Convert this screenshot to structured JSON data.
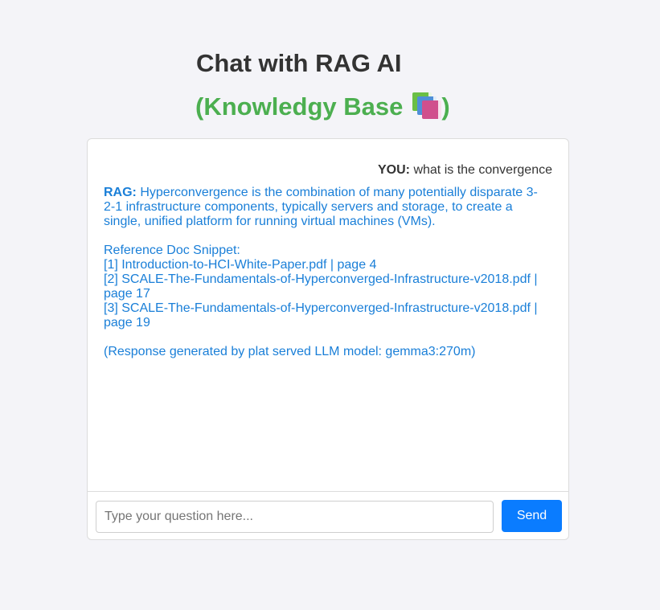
{
  "header": {
    "title": "Chat with RAG AI",
    "subtitle_open": "(Knowledgy Base",
    "subtitle_close": ")",
    "subtitle_icon": "books-icon"
  },
  "chat": {
    "user_message": {
      "speaker": "YOU:",
      "text": "what is the convergence"
    },
    "rag_message": {
      "speaker": "RAG:",
      "answer": "Hyperconvergence is the combination of many potentially disparate 3-2-1 infrastructure components, typically servers and storage, to create a single, unified platform for running virtual machines (VMs).",
      "reference_heading": "Reference Doc Snippet:",
      "references": [
        "[1] Introduction-to-HCI-White-Paper.pdf | page 4",
        "[2] SCALE-The-Fundamentals-of-Hyperconverged-Infrastructure-v2018.pdf | page 17",
        "[3] SCALE-The-Fundamentals-of-Hyperconverged-Infrastructure-v2018.pdf | page 19"
      ],
      "footer": "(Response generated by plat served LLM model: gemma3:270m)"
    }
  },
  "input": {
    "value": "",
    "placeholder": "Type your question here...",
    "send_label": "Send"
  },
  "colors": {
    "background": "#f4f4f8",
    "title": "#333333",
    "subtitle": "#4caf50",
    "rag_text": "#1a7fd8",
    "send_button": "#0a7cff"
  }
}
